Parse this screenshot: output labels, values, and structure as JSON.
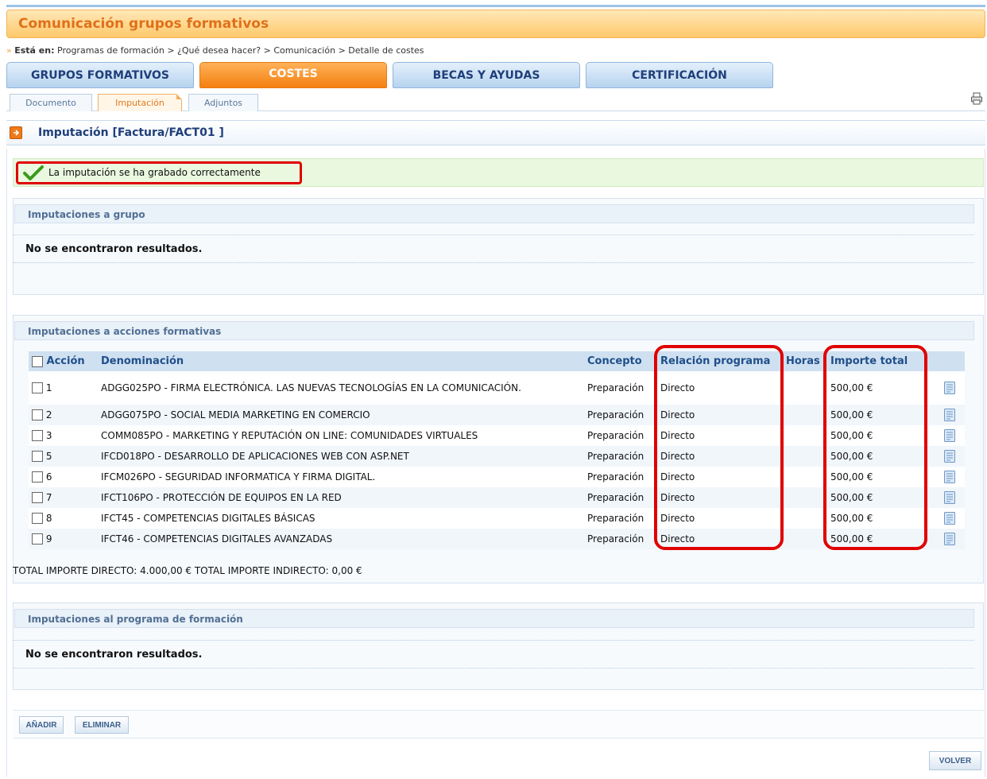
{
  "title": "Comunicación grupos formativos",
  "breadcrumb": {
    "label": "Está en:",
    "path": "Programas de formación > ¿Qué desea hacer? > Comunicación > Detalle de costes"
  },
  "main_tabs": [
    "GRUPOS FORMATIVOS",
    "COSTES",
    "BECAS Y AYUDAS",
    "CERTIFICACIÓN"
  ],
  "sub_tabs": [
    "Documento",
    "Imputación",
    "Adjuntos"
  ],
  "section_title": "Imputación [Factura/FACT01 ]",
  "success_message": "La imputación se ha grabado correctamente",
  "panels": {
    "grupo": {
      "title": "Imputaciones a grupo",
      "empty": "No se encontraron resultados."
    },
    "acciones": {
      "title": "Imputaciones a acciones formativas"
    },
    "programa": {
      "title": "Imputaciones al programa de formación",
      "empty": "No se encontraron resultados."
    }
  },
  "table": {
    "headers": [
      "Acción",
      "Denominación",
      "Concepto",
      "Relación programa",
      "Horas",
      "Importe total"
    ],
    "rows": [
      {
        "accion": "1",
        "denominacion": "ADGG025PO - FIRMA ELECTRÓNICA. LAS NUEVAS TECNOLOGÍAS EN LA COMUNICACIÓN.",
        "concepto": "Preparación",
        "relacion": "Directo",
        "horas": "",
        "importe": "500,00 €"
      },
      {
        "accion": "2",
        "denominacion": "ADGG075PO - SOCIAL MEDIA MARKETING EN COMERCIO",
        "concepto": "Preparación",
        "relacion": "Directo",
        "horas": "",
        "importe": "500,00 €"
      },
      {
        "accion": "3",
        "denominacion": "COMM085PO - MARKETING Y REPUTACIÓN ON LINE: COMUNIDADES VIRTUALES",
        "concepto": "Preparación",
        "relacion": "Directo",
        "horas": "",
        "importe": "500,00 €"
      },
      {
        "accion": "5",
        "denominacion": "IFCD018PO - DESARROLLO DE APLICACIONES WEB CON ASP.NET",
        "concepto": "Preparación",
        "relacion": "Directo",
        "horas": "",
        "importe": "500,00 €"
      },
      {
        "accion": "6",
        "denominacion": "IFCM026PO - SEGURIDAD INFORMATICA Y FIRMA DIGITAL.",
        "concepto": "Preparación",
        "relacion": "Directo",
        "horas": "",
        "importe": "500,00 €"
      },
      {
        "accion": "7",
        "denominacion": "IFCT106PO - PROTECCIÓN DE EQUIPOS EN LA RED",
        "concepto": "Preparación",
        "relacion": "Directo",
        "horas": "",
        "importe": "500,00 €"
      },
      {
        "accion": "8",
        "denominacion": "IFCT45 - COMPETENCIAS DIGITALES BÁSICAS",
        "concepto": "Preparación",
        "relacion": "Directo",
        "horas": "",
        "importe": "500,00 €"
      },
      {
        "accion": "9",
        "denominacion": "IFCT46 - COMPETENCIAS DIGITALES AVANZADAS",
        "concepto": "Preparación",
        "relacion": "Directo",
        "horas": "",
        "importe": "500,00 €"
      }
    ]
  },
  "totals": "TOTAL IMPORTE DIRECTO: 4.000,00 € TOTAL IMPORTE INDIRECTO: 0,00 €",
  "buttons": {
    "add": "AÑADIR",
    "delete": "ELIMINAR",
    "back": "VOLVER"
  },
  "icons": {
    "print": "printer-icon",
    "section": "arrow-right-icon",
    "success": "checkmark-icon",
    "row_detail": "document-icon"
  },
  "colors": {
    "accent_orange": "#f47f10",
    "header_blue": "#1f3f7a",
    "highlight_red": "#e00000",
    "success_bg": "#e9f8df"
  }
}
